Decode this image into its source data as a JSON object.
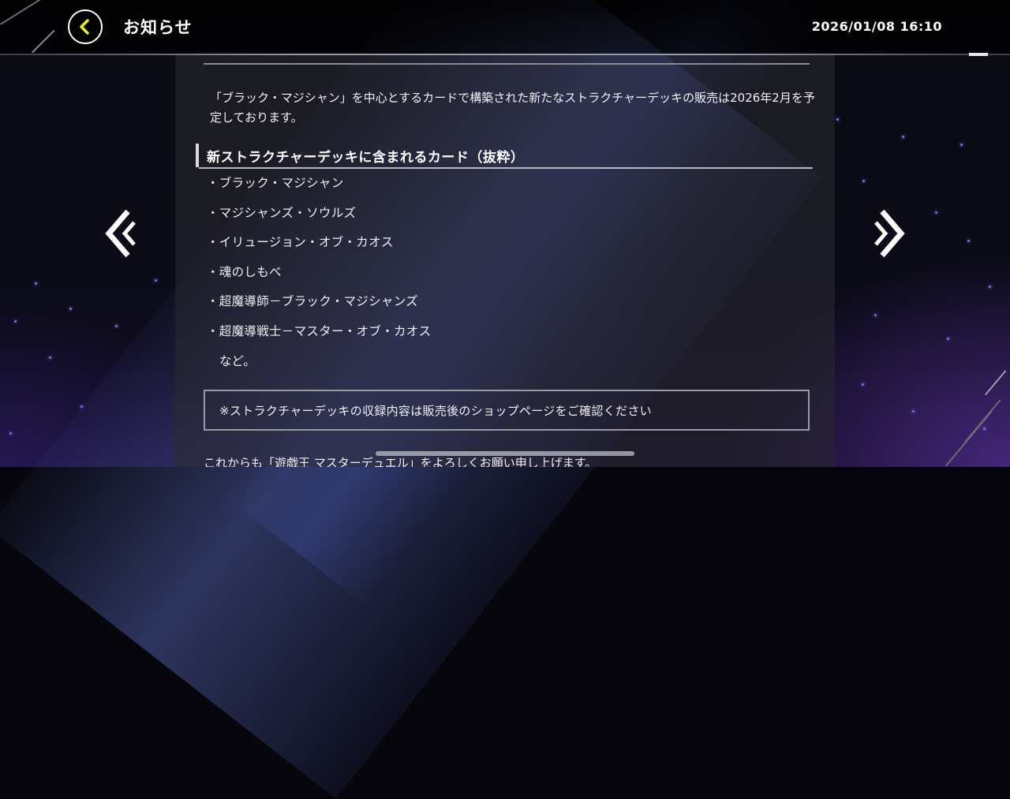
{
  "header": {
    "title": "お知らせ",
    "datetime": "2026/01/08 16:10",
    "back_icon": "chevron-left-icon",
    "accent_color": "#e8f01a"
  },
  "navigation": {
    "prev_icon": "double-chevron-left-icon",
    "next_icon": "double-chevron-right-icon"
  },
  "article": {
    "intro": "「ブラック・マジシャン」を中心とするカードで構築された新たなストラクチャーデッキの販売は2026年2月を予定しております。",
    "section_heading": "新ストラクチャーデッキに含まれるカード（抜粋）",
    "cards": [
      "・ブラック・マジシャン",
      "・マジシャンズ・ソウルズ",
      "・イリュージョン・オブ・カオス",
      "・魂のしもべ",
      "・超魔導師－ブラック・マジシャンズ",
      "・超魔導戦士－マスター・オブ・カオス"
    ],
    "etc": "など。",
    "notice": "※ストラクチャーデッキの収録内容は販売後のショップページをご確認ください",
    "closing": "これからも「遊戯王 マスターデュエル」をよろしくお願い申し上げます。"
  }
}
